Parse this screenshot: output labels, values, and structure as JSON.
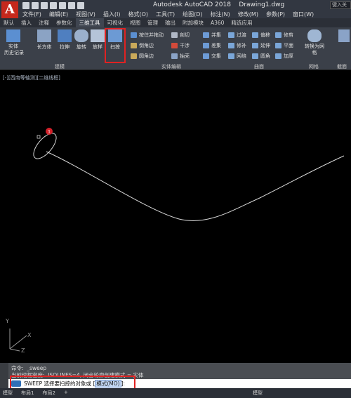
{
  "window": {
    "app_title": "Autodesk AutoCAD 2018    Drawing1.dwg",
    "search_placeholder": "键入关",
    "logo_letter": "A"
  },
  "menubar": [
    "文件(F)",
    "编辑(E)",
    "视图(V)",
    "插入(I)",
    "格式(O)",
    "工具(T)",
    "绘图(D)",
    "标注(N)",
    "修改(M)",
    "参数(P)",
    "窗口(W)"
  ],
  "ribbon_tabs": [
    "默认",
    "插入",
    "注释",
    "参数化",
    "三维工具",
    "可视化",
    "视图",
    "管理",
    "输出",
    "附加模块",
    "A360",
    "精选应用"
  ],
  "ribbon_active_tab": "三维工具",
  "ribbon": {
    "history_label": "实体\n历史记录",
    "modeling_buttons": [
      "长方体",
      "拉伸",
      "旋转",
      "放样",
      "扫掠"
    ],
    "solid_edit_col1": [
      "按住并拖动",
      "倒角边",
      "圆角边"
    ],
    "solid_edit_col2": [
      "剖切",
      "干涉",
      "抽壳"
    ],
    "solid_edit_col3": [
      "并集",
      "差集",
      "交集"
    ],
    "surface_col1": [
      "过渡",
      "修补",
      "网络"
    ],
    "surface_col2": [
      "偏移",
      "延伸",
      "圆角"
    ],
    "surface_col3": [
      "修剪",
      "平面",
      "加厚"
    ],
    "mesh_convert": "转换为网格",
    "panel_labels": [
      "建模",
      "实体编辑",
      "曲面",
      "网格",
      "截面"
    ]
  },
  "viewport_label": "[-][西南等轴测][二维线框]",
  "ucs": {
    "x": "X",
    "y": "Y",
    "z": "Z"
  },
  "command": {
    "history_line1": "命令:  _sweep",
    "history_line2": "当前线框密度:  ISOLINES=4, 闭合轮廓创建模式 = 实体",
    "prompt_prefix": "SWEEP 选择要扫掠的对象或 [",
    "prompt_option": "模式(MO)",
    "prompt_suffix": "]:"
  },
  "statusbar": {
    "layout_tabs": [
      "模型",
      "布局1",
      "布局2",
      "+"
    ],
    "model_label": "模型"
  },
  "colors": {
    "highlight": "#e02222",
    "marker": "#d4212a",
    "ribbon_bg": "#3b4049",
    "canvas_bg": "#000000"
  }
}
